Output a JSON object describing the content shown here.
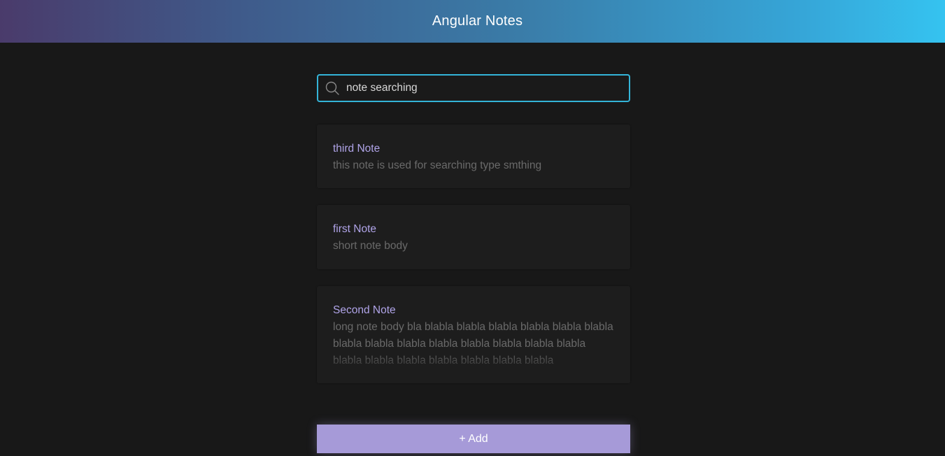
{
  "app": {
    "title": "Angular Notes"
  },
  "search": {
    "value": "note searching",
    "icon": "search-icon"
  },
  "notes": [
    {
      "title": "third Note",
      "body": "this note is used for searching type smthing"
    },
    {
      "title": "first Note",
      "body": "short note body"
    },
    {
      "title": "Second Note",
      "body": "long note body bla blabla blabla blabla blabla blabla blabla blabla blabla blabla blabla blabla blabla blabla blabla blabla blabla blabla blabla blabla blabla blabla"
    }
  ],
  "actions": {
    "add_label": "+ Add"
  },
  "colors": {
    "header_gradient_start": "#4a3b6b",
    "header_gradient_end": "#35c3f0",
    "accent": "#a69ad8",
    "note_title": "#b0a4e8",
    "search_border": "#34b4d8",
    "background": "#181818"
  }
}
